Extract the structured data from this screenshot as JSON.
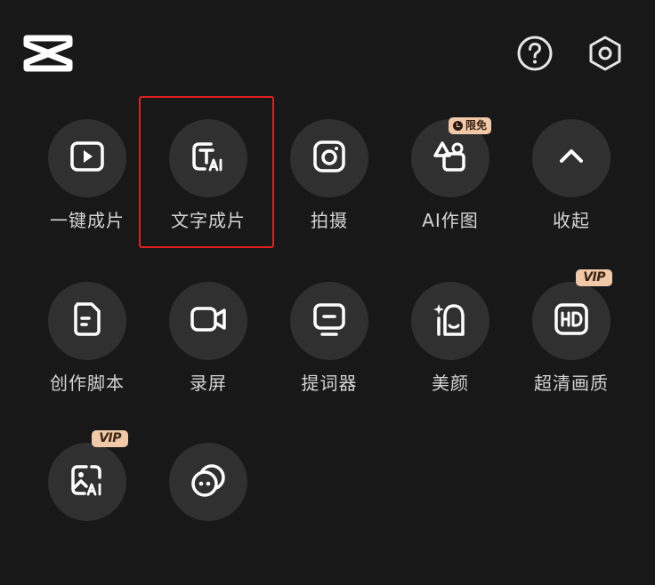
{
  "header": {
    "logo_icon": "capcut-logo",
    "help_icon": "question-circle-icon",
    "settings_icon": "hexagon-gear-icon"
  },
  "tools": [
    {
      "label": "一键成片",
      "icon": "play-square-icon"
    },
    {
      "label": "文字成片",
      "icon": "text-ai-icon",
      "highlighted": true
    },
    {
      "label": "拍摄",
      "icon": "camera-icon"
    },
    {
      "label": "AI作图",
      "icon": "shapes-icon",
      "badge": "限免"
    },
    {
      "label": "收起",
      "icon": "chevron-up-icon"
    },
    {
      "label": "创作脚本",
      "icon": "document-icon"
    },
    {
      "label": "录屏",
      "icon": "video-camera-icon"
    },
    {
      "label": "提词器",
      "icon": "teleprompter-icon"
    },
    {
      "label": "美颜",
      "icon": "beauty-icon"
    },
    {
      "label": "超清画质",
      "icon": "hd-icon",
      "badge": "VIP"
    },
    {
      "label": "",
      "icon": "image-ai-icon",
      "badge": "VIP"
    },
    {
      "label": "",
      "icon": "face-circles-icon"
    }
  ],
  "colors": {
    "background": "#181818",
    "circle": "#303030",
    "badge": "#f1c9a9",
    "highlight_border": "#e02020"
  }
}
